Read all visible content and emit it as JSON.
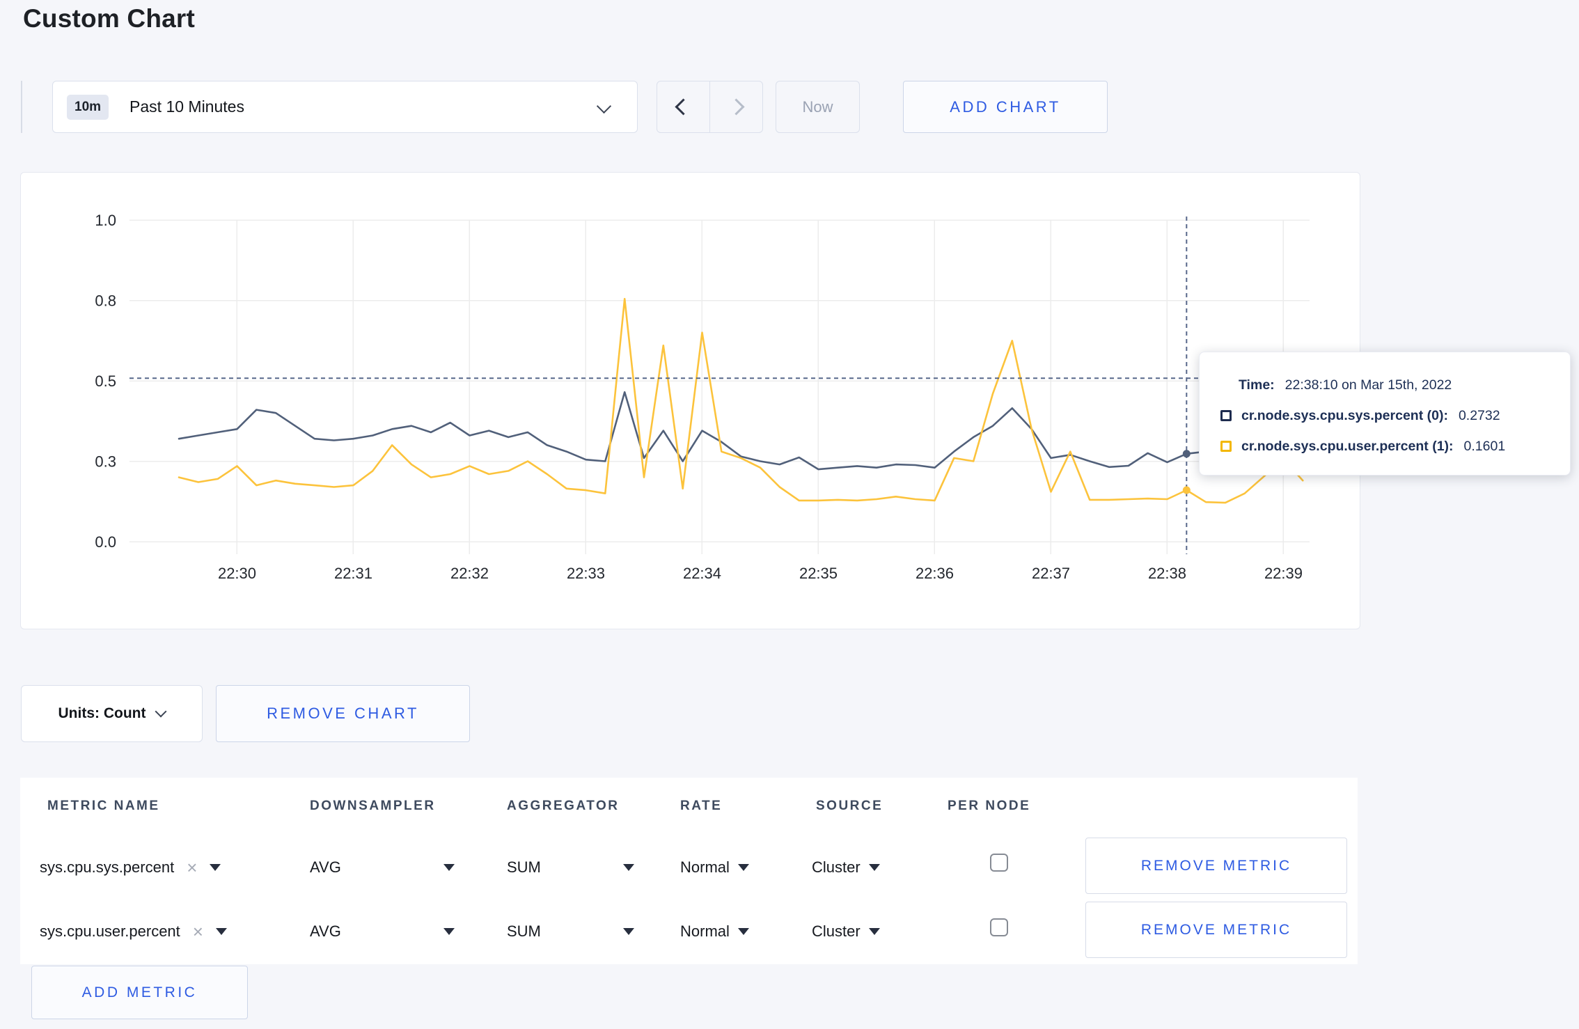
{
  "page": {
    "title": "Custom Chart",
    "background": "#f5f6fa",
    "accent_blue": "#2e5be2"
  },
  "toolbar": {
    "time_badge": "10m",
    "time_label": "Past 10 Minutes",
    "now_label": "Now",
    "add_chart_label": "ADD CHART"
  },
  "tooltip": {
    "time_label": "Time:",
    "time_value": "22:38:10 on Mar 15th, 2022",
    "series": [
      {
        "label": "cr.node.sys.cpu.sys.percent (0):",
        "value": "0.2732",
        "swatch_color": "#1e2c4f"
      },
      {
        "label": "cr.node.sys.cpu.user.percent (1):",
        "value": "0.1601",
        "swatch_color": "#f3b704"
      }
    ]
  },
  "units": {
    "label": "Units: Count"
  },
  "remove_chart_label": "REMOVE CHART",
  "metrics_table": {
    "headers": [
      "METRIC NAME",
      "DOWNSAMPLER",
      "AGGREGATOR",
      "RATE",
      "SOURCE",
      "PER NODE"
    ],
    "rows": [
      {
        "name": "sys.cpu.sys.percent",
        "remove_tag": "×",
        "downsampler": "AVG",
        "aggregator": "SUM",
        "rate": "Normal",
        "source": "Cluster",
        "per_node_checked": false,
        "remove_label": "REMOVE METRIC"
      },
      {
        "name": "sys.cpu.user.percent",
        "remove_tag": "×",
        "downsampler": "AVG",
        "aggregator": "SUM",
        "rate": "Normal",
        "source": "Cluster",
        "per_node_checked": false,
        "remove_label": "REMOVE METRIC"
      }
    ],
    "add_metric_label": "ADD METRIC"
  },
  "chart_data": {
    "type": "line",
    "title": "",
    "xlabel": "",
    "ylabel": "",
    "ylim": [
      0,
      1
    ],
    "grid": true,
    "x_ticks": [
      "22:30",
      "22:31",
      "22:32",
      "22:33",
      "22:34",
      "22:35",
      "22:36",
      "22:37",
      "22:38",
      "22:39"
    ],
    "y_ticks": [
      {
        "value": 1.0,
        "label": "1.0"
      },
      {
        "value": 0.75,
        "label": "0.8"
      },
      {
        "value": 0.5,
        "label": "0.5"
      },
      {
        "value": 0.25,
        "label": "0.3"
      },
      {
        "value": 0.0,
        "label": "0.0"
      }
    ],
    "start_time": "22:29:30",
    "point_interval_seconds": 10,
    "series": [
      {
        "name": "cr.node.sys.cpu.sys.percent",
        "color": "#51607a",
        "values": [
          0.32,
          0.33,
          0.34,
          0.35,
          0.41,
          0.4,
          0.36,
          0.32,
          0.315,
          0.32,
          0.33,
          0.35,
          0.36,
          0.34,
          0.37,
          0.33,
          0.345,
          0.325,
          0.34,
          0.3,
          0.28,
          0.255,
          0.25,
          0.465,
          0.26,
          0.345,
          0.25,
          0.345,
          0.31,
          0.265,
          0.25,
          0.24,
          0.262,
          0.225,
          0.23,
          0.235,
          0.23,
          0.24,
          0.238,
          0.23,
          0.28,
          0.325,
          0.36,
          0.415,
          0.35,
          0.26,
          0.27,
          0.25,
          0.232,
          0.236,
          0.275,
          0.247,
          0.2732,
          0.28,
          0.27,
          0.28,
          0.295,
          0.3,
          0.29
        ]
      },
      {
        "name": "cr.node.sys.cpu.user.percent",
        "color": "#fcc33c",
        "values": [
          0.2,
          0.185,
          0.195,
          0.235,
          0.175,
          0.19,
          0.18,
          0.175,
          0.17,
          0.175,
          0.22,
          0.3,
          0.24,
          0.2,
          0.21,
          0.235,
          0.21,
          0.22,
          0.25,
          0.21,
          0.165,
          0.16,
          0.15,
          0.755,
          0.2,
          0.61,
          0.165,
          0.65,
          0.28,
          0.26,
          0.23,
          0.17,
          0.128,
          0.128,
          0.13,
          0.128,
          0.132,
          0.14,
          0.132,
          0.128,
          0.26,
          0.25,
          0.46,
          0.625,
          0.35,
          0.155,
          0.28,
          0.13,
          0.13,
          0.132,
          0.134,
          0.132,
          0.1601,
          0.123,
          0.121,
          0.15,
          0.203,
          0.257,
          0.19
        ]
      }
    ],
    "crosshair": {
      "hover_index": 52,
      "hover_time": "22:38:10",
      "horizontal_value": 0.508
    },
    "legend_position": "tooltip"
  }
}
